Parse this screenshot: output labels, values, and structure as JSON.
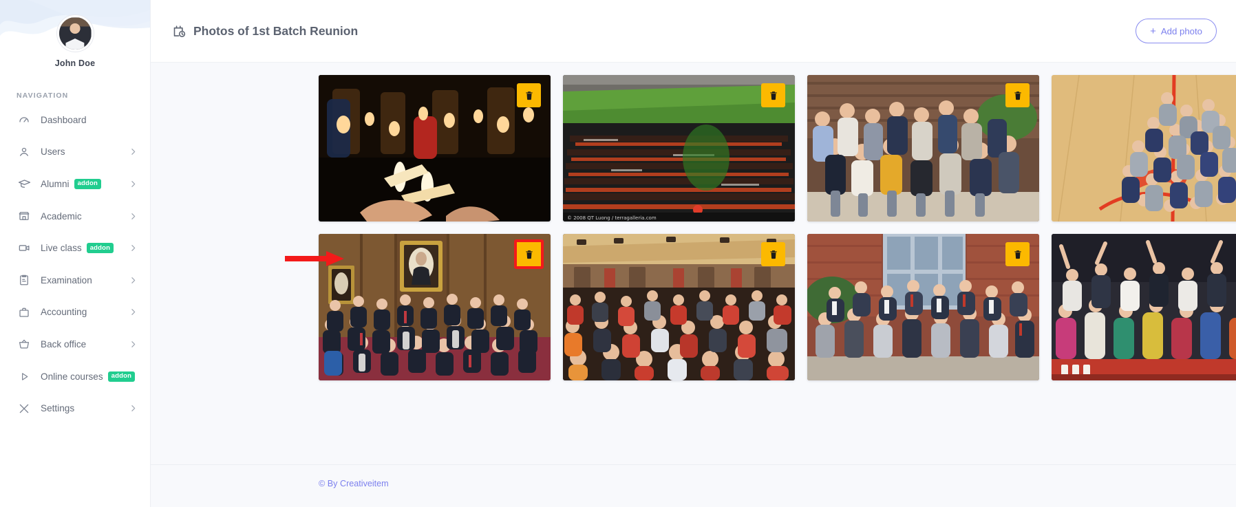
{
  "sidebar": {
    "profile": {
      "name": "John Doe",
      "avatar_alt": "user-avatar"
    },
    "nav_heading": "NAVIGATION",
    "items": [
      {
        "label": "Dashboard",
        "icon": "speedometer-icon",
        "badge": null,
        "chevron": false
      },
      {
        "label": "Users",
        "icon": "user-icon",
        "badge": null,
        "chevron": true
      },
      {
        "label": "Alumni",
        "icon": "graduation-cap-icon",
        "badge": "addon",
        "chevron": true
      },
      {
        "label": "Academic",
        "icon": "bank-icon",
        "badge": null,
        "chevron": true
      },
      {
        "label": "Live class",
        "icon": "video-camera-icon",
        "badge": "addon",
        "chevron": true
      },
      {
        "label": "Examination",
        "icon": "clipboard-icon",
        "badge": null,
        "chevron": true
      },
      {
        "label": "Accounting",
        "icon": "briefcase-icon",
        "badge": null,
        "chevron": true
      },
      {
        "label": "Back office",
        "icon": "basket-icon",
        "badge": null,
        "chevron": true
      },
      {
        "label": "Online courses",
        "icon": "play-icon",
        "badge": "addon",
        "chevron": false
      },
      {
        "label": "Settings",
        "icon": "tools-icon",
        "badge": null,
        "chevron": true
      }
    ]
  },
  "header": {
    "title": "Photos of 1st Batch Reunion",
    "title_icon": "calendar-clock-icon",
    "add_photo_label": "Add photo",
    "add_photo_plus": "+"
  },
  "gallery": {
    "delete_icon": "trash-icon",
    "photos": [
      {
        "caption": "candlelight-vigil",
        "delete_label": "Delete",
        "highlighted": false
      },
      {
        "caption": "stadium-graduation",
        "delete_label": "Delete",
        "highlighted": false
      },
      {
        "caption": "students-group-outdoors",
        "delete_label": "Delete",
        "highlighted": false
      },
      {
        "caption": "gym-floor-group",
        "delete_label": "Delete",
        "highlighted": false
      },
      {
        "caption": "formal-class-portrait",
        "delete_label": "Delete",
        "highlighted": true
      },
      {
        "caption": "auditorium-audience",
        "delete_label": "Delete",
        "highlighted": false
      },
      {
        "caption": "faculty-group-photo",
        "delete_label": "Delete",
        "highlighted": false
      },
      {
        "caption": "celebration-crowd",
        "delete_label": "Delete",
        "highlighted": false
      }
    ]
  },
  "annotation": {
    "type": "red-arrow",
    "points_to": "delete-button-photo-5"
  },
  "footer": {
    "text": "© By Creativeitem"
  },
  "colors": {
    "accent_indigo": "#7c80ee",
    "badge_green": "#21cd8f",
    "delete_amber": "#fcb900",
    "annotation_red": "#f31a1a",
    "page_bg": "#f8f9fc"
  }
}
